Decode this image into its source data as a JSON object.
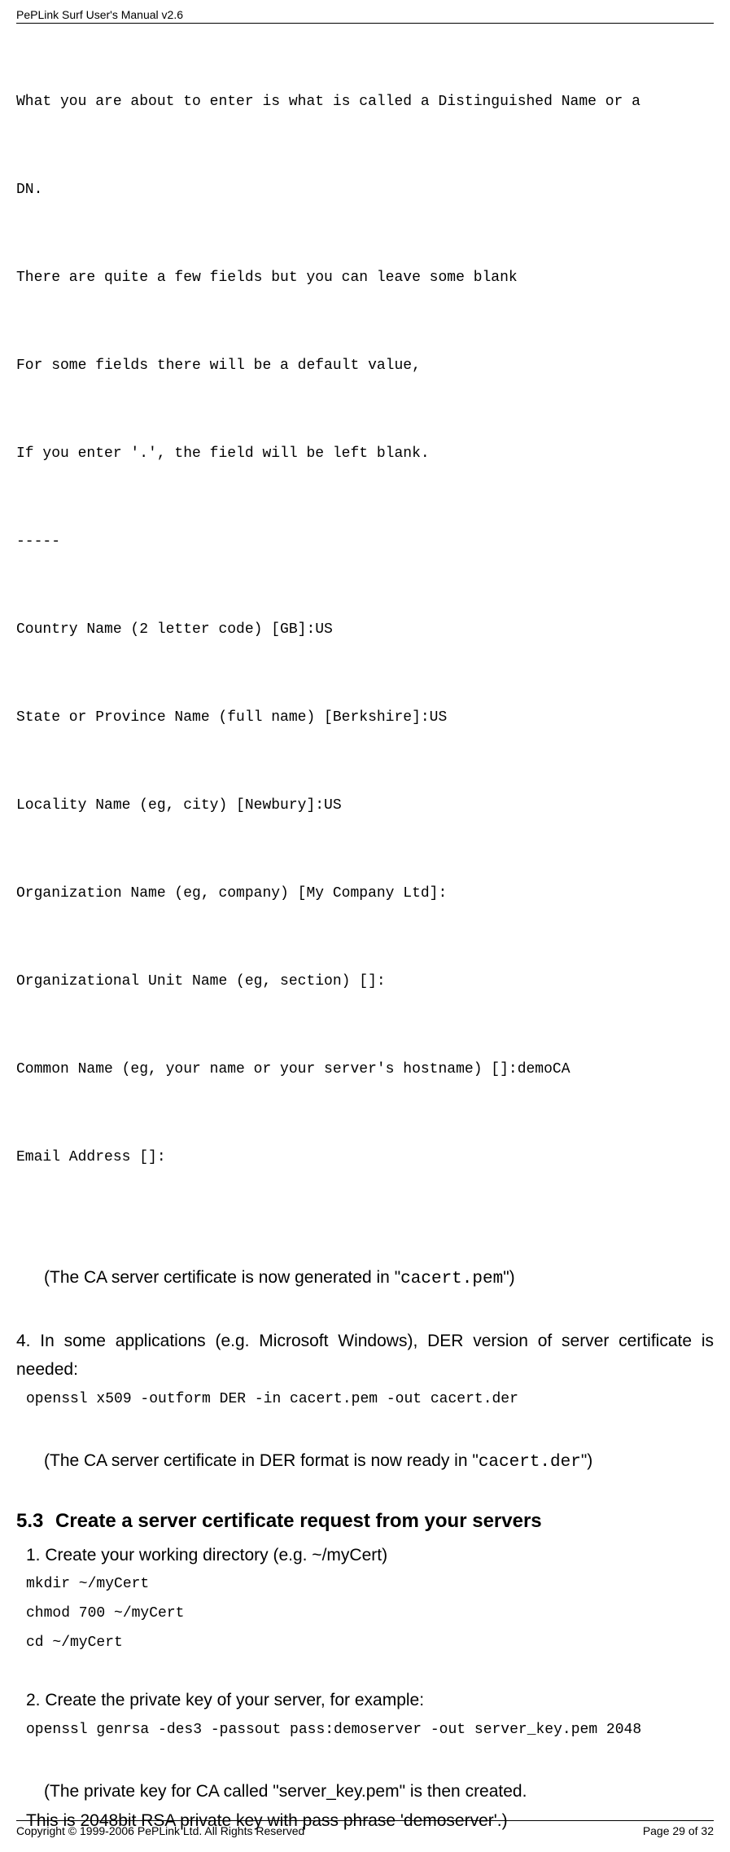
{
  "header": {
    "title": "PePLink Surf User's Manual v2.6"
  },
  "block1": {
    "lines": [
      "What you are about to enter is what is called a Distinguished Name or a",
      "DN.",
      "There are quite a few fields but you can leave some blank",
      "For some fields there will be a default value,",
      "If you enter '.', the field will be left blank.",
      "-----",
      "Country Name (2 letter code) [GB]:US",
      "State or Province Name (full name) [Berkshire]:US",
      "Locality Name (eg, city) [Newbury]:US",
      "Organization Name (eg, company) [My Company Ltd]:",
      "Organizational Unit Name (eg, section) []:",
      "Common Name (eg, your name or your server's hostname) []:demoCA",
      "Email Address []:"
    ]
  },
  "note1": {
    "prefix": "(The CA server certificate is now generated in \"",
    "code": "cacert.pem",
    "suffix": "\")"
  },
  "step4": {
    "text": "4. In some applications (e.g. Microsoft Windows), DER version of server certificate is needed:",
    "code": "openssl x509 -outform DER -in cacert.pem -out cacert.der"
  },
  "note2": {
    "prefix": "(The CA server certificate in DER format is now ready in \"",
    "code": "cacert.der",
    "suffix": "\")"
  },
  "section53": {
    "num": "5.3",
    "title": "Create a server certificate request from your servers"
  },
  "s53_step1": {
    "text": "1. Create your working directory (e.g. ~/myCert)",
    "code1": "mkdir ~/myCert",
    "code2": "chmod 700 ~/myCert",
    "code3": "cd ~/myCert"
  },
  "s53_step2": {
    "text": "2. Create the private key of your server, for example:",
    "code": "openssl genrsa -des3 -passout pass:demoserver -out server_key.pem 2048"
  },
  "note3": {
    "line1": "(The private key for CA called \"server_key.pem\" is then created.",
    "line2": "This is 2048bit RSA private key with pass phrase 'demoserver'.)"
  },
  "footer": {
    "copyright": "Copyright © 1999-2006 PePLink Ltd. All Rights Reserved",
    "page": "Page 29 of 32"
  }
}
